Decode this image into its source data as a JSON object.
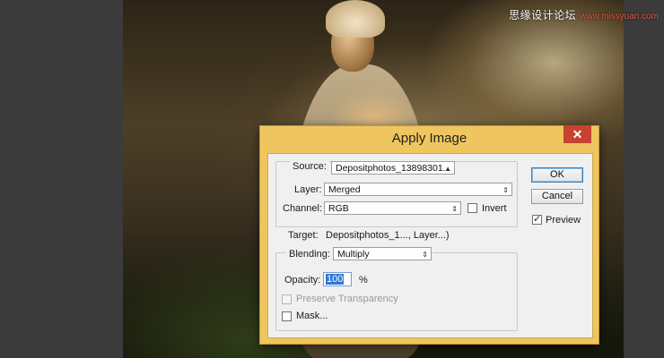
{
  "watermark": {
    "text": "思缘设计论坛",
    "site": "www.missyuan.com"
  },
  "dialog": {
    "title": "Apply Image",
    "close_label": "✕",
    "source": {
      "label": "Source:",
      "value": "Depositphotos_13898301..."
    },
    "layer": {
      "label": "Layer:",
      "value": "Merged"
    },
    "channel": {
      "label": "Channel:",
      "value": "RGB"
    },
    "invert": {
      "label": "Invert",
      "checked": false
    },
    "target": {
      "label": "Target:",
      "value": "Depositphotos_1..., Layer...)"
    },
    "blending": {
      "label": "Blending:",
      "value": "Multiply"
    },
    "opacity": {
      "label": "Opacity:",
      "value": "100",
      "unit": "%"
    },
    "preserve_transparency": {
      "label": "Preserve Transparency",
      "checked": false,
      "disabled": true
    },
    "mask": {
      "label": "Mask...",
      "checked": false
    },
    "buttons": {
      "ok": "OK",
      "cancel": "Cancel"
    },
    "preview": {
      "label": "Preview",
      "checked": true
    }
  }
}
